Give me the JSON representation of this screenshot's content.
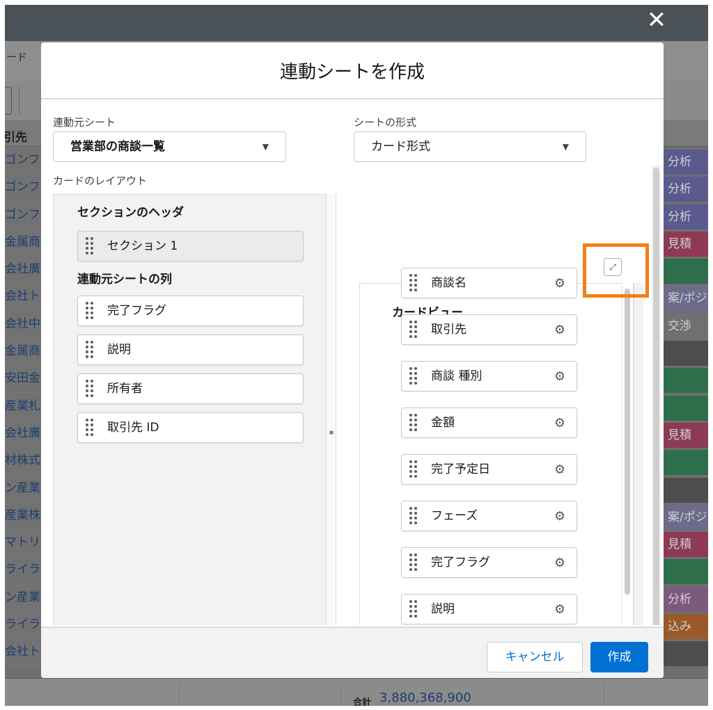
{
  "background": {
    "tab_label": "ード",
    "column_header": "引先",
    "rows": [
      "ゴンフ",
      "ゴンフ",
      "ゴンフ",
      "金属商",
      "会社廣",
      "会社ト",
      "会社中",
      "金属商",
      "安田金",
      "産業札",
      "会社廣",
      "材株式",
      "ン産業",
      "産業株",
      "マトリ",
      "ライラ",
      "ン産業",
      "ライラ",
      "会社ト"
    ],
    "status_chips": [
      {
        "text": "分析",
        "color": "#5a5a8e"
      },
      {
        "text": "分析",
        "color": "#5a5a8e"
      },
      {
        "text": "分析",
        "color": "#5a5a8e"
      },
      {
        "text": "見積",
        "color": "#8e3a55"
      },
      {
        "text": "",
        "color": "#2f6e4a"
      },
      {
        "text": "案/ポジ",
        "color": "#6b6b8c"
      },
      {
        "text": "交渉",
        "color": "#707070"
      },
      {
        "text": "",
        "color": "#4d4d4d"
      },
      {
        "text": "",
        "color": "#2f6e4a"
      },
      {
        "text": "",
        "color": "#2f6e4a"
      },
      {
        "text": "見積",
        "color": "#8e3a55"
      },
      {
        "text": "",
        "color": "#2f6e4a"
      },
      {
        "text": "",
        "color": "#4d4d4d"
      },
      {
        "text": "案/ポジ",
        "color": "#6b6b8c"
      },
      {
        "text": "見積",
        "color": "#8e3a55"
      },
      {
        "text": "",
        "color": "#2f6e4a"
      },
      {
        "text": "分析",
        "color": "#7d5a7d"
      },
      {
        "text": "込み",
        "color": "#9a5a2a"
      },
      {
        "text": "",
        "color": "#4d4d4d"
      }
    ],
    "total_label": "合計",
    "total_value": "3,880,368,900"
  },
  "close_symbol": "✕",
  "modal": {
    "title": "連動シートを作成",
    "source_sheet_label": "連動元シート",
    "source_sheet_value": "営業部の商談一覧",
    "sheet_format_label": "シートの形式",
    "sheet_format_value": "カード形式",
    "card_layout_label": "カードのレイアウト",
    "section_header_title": "セクションのヘッダ",
    "section_item": "セクション 1",
    "source_columns_title": "連動元シートの列",
    "source_columns": [
      "完了フラグ",
      "説明",
      "所有者",
      "取引先 ID"
    ],
    "card_view_title": "カードビュー",
    "card_fields": [
      "商談名",
      "取引先",
      "商談 種別",
      "金額",
      "完了予定日",
      "フェーズ",
      "完了フラグ",
      "説明"
    ],
    "cancel_label": "キャンセル",
    "create_label": "作成",
    "accent_color": "#0070d2",
    "highlight_color": "#f47f17"
  }
}
